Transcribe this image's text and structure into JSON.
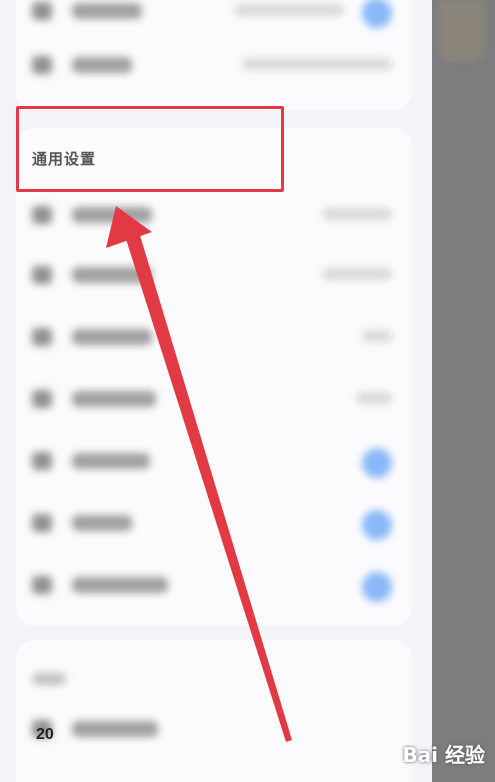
{
  "settings": {
    "section_title": "通用设置"
  },
  "blurred_rows": [
    {
      "has_icon": true,
      "control": "toggle"
    },
    {
      "has_icon": true,
      "control": "value"
    },
    {
      "has_icon": true,
      "control": "value"
    },
    {
      "has_icon": true,
      "control": "value"
    },
    {
      "has_icon": true,
      "control": "value"
    },
    {
      "has_icon": true,
      "control": "value"
    },
    {
      "has_icon": true,
      "control": "toggle"
    },
    {
      "has_icon": true,
      "control": "toggle"
    },
    {
      "has_icon": true,
      "control": "toggle"
    },
    {
      "has_icon": true,
      "control": "none"
    }
  ],
  "stray_text": "20",
  "watermark": "Bai 经验",
  "colors": {
    "highlight": "#e23a44",
    "arrow": "#e23a44",
    "toggle_on": "#3d8cf5",
    "overlay": "#7d7d7f"
  }
}
